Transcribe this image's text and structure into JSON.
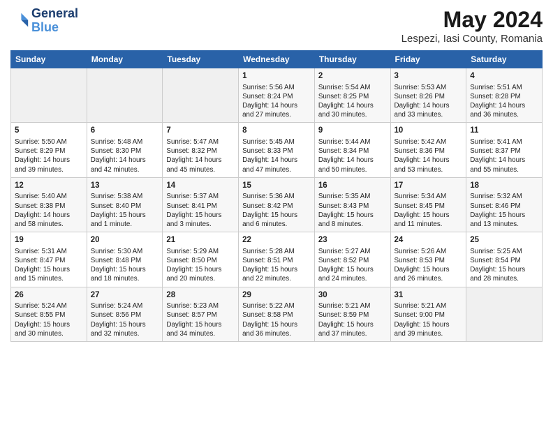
{
  "header": {
    "logo_line1": "General",
    "logo_line2": "Blue",
    "main_title": "May 2024",
    "subtitle": "Lespezi, Iasi County, Romania"
  },
  "calendar": {
    "days_of_week": [
      "Sunday",
      "Monday",
      "Tuesday",
      "Wednesday",
      "Thursday",
      "Friday",
      "Saturday"
    ],
    "weeks": [
      [
        {
          "day": "",
          "info": ""
        },
        {
          "day": "",
          "info": ""
        },
        {
          "day": "",
          "info": ""
        },
        {
          "day": "1",
          "info": "Sunrise: 5:56 AM\nSunset: 8:24 PM\nDaylight: 14 hours\nand 27 minutes."
        },
        {
          "day": "2",
          "info": "Sunrise: 5:54 AM\nSunset: 8:25 PM\nDaylight: 14 hours\nand 30 minutes."
        },
        {
          "day": "3",
          "info": "Sunrise: 5:53 AM\nSunset: 8:26 PM\nDaylight: 14 hours\nand 33 minutes."
        },
        {
          "day": "4",
          "info": "Sunrise: 5:51 AM\nSunset: 8:28 PM\nDaylight: 14 hours\nand 36 minutes."
        }
      ],
      [
        {
          "day": "5",
          "info": "Sunrise: 5:50 AM\nSunset: 8:29 PM\nDaylight: 14 hours\nand 39 minutes."
        },
        {
          "day": "6",
          "info": "Sunrise: 5:48 AM\nSunset: 8:30 PM\nDaylight: 14 hours\nand 42 minutes."
        },
        {
          "day": "7",
          "info": "Sunrise: 5:47 AM\nSunset: 8:32 PM\nDaylight: 14 hours\nand 45 minutes."
        },
        {
          "day": "8",
          "info": "Sunrise: 5:45 AM\nSunset: 8:33 PM\nDaylight: 14 hours\nand 47 minutes."
        },
        {
          "day": "9",
          "info": "Sunrise: 5:44 AM\nSunset: 8:34 PM\nDaylight: 14 hours\nand 50 minutes."
        },
        {
          "day": "10",
          "info": "Sunrise: 5:42 AM\nSunset: 8:36 PM\nDaylight: 14 hours\nand 53 minutes."
        },
        {
          "day": "11",
          "info": "Sunrise: 5:41 AM\nSunset: 8:37 PM\nDaylight: 14 hours\nand 55 minutes."
        }
      ],
      [
        {
          "day": "12",
          "info": "Sunrise: 5:40 AM\nSunset: 8:38 PM\nDaylight: 14 hours\nand 58 minutes."
        },
        {
          "day": "13",
          "info": "Sunrise: 5:38 AM\nSunset: 8:40 PM\nDaylight: 15 hours\nand 1 minute."
        },
        {
          "day": "14",
          "info": "Sunrise: 5:37 AM\nSunset: 8:41 PM\nDaylight: 15 hours\nand 3 minutes."
        },
        {
          "day": "15",
          "info": "Sunrise: 5:36 AM\nSunset: 8:42 PM\nDaylight: 15 hours\nand 6 minutes."
        },
        {
          "day": "16",
          "info": "Sunrise: 5:35 AM\nSunset: 8:43 PM\nDaylight: 15 hours\nand 8 minutes."
        },
        {
          "day": "17",
          "info": "Sunrise: 5:34 AM\nSunset: 8:45 PM\nDaylight: 15 hours\nand 11 minutes."
        },
        {
          "day": "18",
          "info": "Sunrise: 5:32 AM\nSunset: 8:46 PM\nDaylight: 15 hours\nand 13 minutes."
        }
      ],
      [
        {
          "day": "19",
          "info": "Sunrise: 5:31 AM\nSunset: 8:47 PM\nDaylight: 15 hours\nand 15 minutes."
        },
        {
          "day": "20",
          "info": "Sunrise: 5:30 AM\nSunset: 8:48 PM\nDaylight: 15 hours\nand 18 minutes."
        },
        {
          "day": "21",
          "info": "Sunrise: 5:29 AM\nSunset: 8:50 PM\nDaylight: 15 hours\nand 20 minutes."
        },
        {
          "day": "22",
          "info": "Sunrise: 5:28 AM\nSunset: 8:51 PM\nDaylight: 15 hours\nand 22 minutes."
        },
        {
          "day": "23",
          "info": "Sunrise: 5:27 AM\nSunset: 8:52 PM\nDaylight: 15 hours\nand 24 minutes."
        },
        {
          "day": "24",
          "info": "Sunrise: 5:26 AM\nSunset: 8:53 PM\nDaylight: 15 hours\nand 26 minutes."
        },
        {
          "day": "25",
          "info": "Sunrise: 5:25 AM\nSunset: 8:54 PM\nDaylight: 15 hours\nand 28 minutes."
        }
      ],
      [
        {
          "day": "26",
          "info": "Sunrise: 5:24 AM\nSunset: 8:55 PM\nDaylight: 15 hours\nand 30 minutes."
        },
        {
          "day": "27",
          "info": "Sunrise: 5:24 AM\nSunset: 8:56 PM\nDaylight: 15 hours\nand 32 minutes."
        },
        {
          "day": "28",
          "info": "Sunrise: 5:23 AM\nSunset: 8:57 PM\nDaylight: 15 hours\nand 34 minutes."
        },
        {
          "day": "29",
          "info": "Sunrise: 5:22 AM\nSunset: 8:58 PM\nDaylight: 15 hours\nand 36 minutes."
        },
        {
          "day": "30",
          "info": "Sunrise: 5:21 AM\nSunset: 8:59 PM\nDaylight: 15 hours\nand 37 minutes."
        },
        {
          "day": "31",
          "info": "Sunrise: 5:21 AM\nSunset: 9:00 PM\nDaylight: 15 hours\nand 39 minutes."
        },
        {
          "day": "",
          "info": ""
        }
      ]
    ]
  }
}
